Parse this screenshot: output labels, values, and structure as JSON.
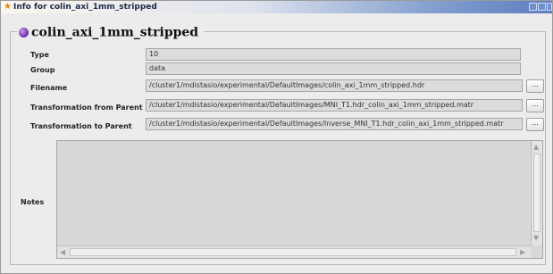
{
  "window": {
    "title": "Info for colin_axi_1mm_stripped"
  },
  "object": {
    "name": "colin_axi_1mm_stripped",
    "icon": "object-sphere-icon"
  },
  "fields": [
    {
      "label": "Type",
      "value": "10",
      "has_browse": false
    },
    {
      "label": "Group",
      "value": "data",
      "has_browse": false
    },
    {
      "label": "Filename",
      "value": "/cluster1/mdistasio/experimental/DefaultImages/colin_axi_1mm_stripped.hdr",
      "has_browse": true
    },
    {
      "label": "Transformation from Parent",
      "value": "/cluster1/mdistasio/experimental/DefaultImages/MNI_T1.hdr_colin_axi_1mm_stripped.matr",
      "has_browse": true
    },
    {
      "label": "Transformation to Parent",
      "value": "/cluster1/mdistasio/experimental/DefaultImages/Inverse_MNI_T1.hdr_colin_axi_1mm_stripped.matr",
      "has_browse": true
    }
  ],
  "browse_label": "...",
  "notes": {
    "label": "Notes",
    "value": ""
  }
}
